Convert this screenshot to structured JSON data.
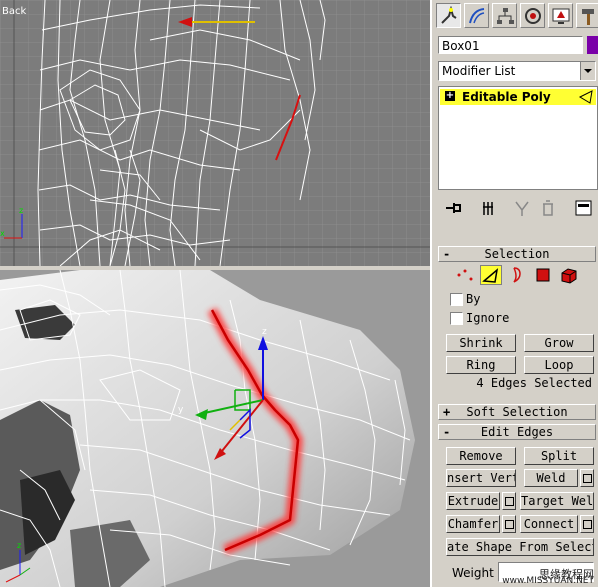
{
  "viewports": {
    "back_label": "Back"
  },
  "panel": {
    "tabs": [
      "create-tab",
      "modify-tab",
      "hierarchy-tab",
      "motion-tab",
      "display-tab",
      "utilities-tab"
    ],
    "object_name": "Box01",
    "object_color": "#7a00a8",
    "modifier_list": "Modifier List",
    "stack_item": "Editable Poly",
    "selection": {
      "title": "Selection",
      "by_label": "By",
      "ignore_label": "Ignore",
      "shrink": "Shrink",
      "grow": "Grow",
      "ring": "Ring",
      "loop": "Loop",
      "status": "4 Edges Selected"
    },
    "soft_selection": {
      "title": "Soft Selection"
    },
    "edit_edges": {
      "title": "Edit Edges",
      "remove": "Remove",
      "split": "Split",
      "insert_vertex": "nsert Verte",
      "weld": "Weld",
      "extrude": "Extrude",
      "target_weld": "Target Weld",
      "chamfer": "Chamfer",
      "connect": "Connect",
      "create_shape": "ate Shape From Select",
      "weight_label": "Weight"
    }
  },
  "watermark": {
    "cn": "思缘教程网",
    "url": "www.MISSYUAN.NET"
  },
  "colors": {
    "accent_yellow": "#ffff33",
    "selection_red": "#e01010",
    "viewport_border": "#e8e800"
  }
}
